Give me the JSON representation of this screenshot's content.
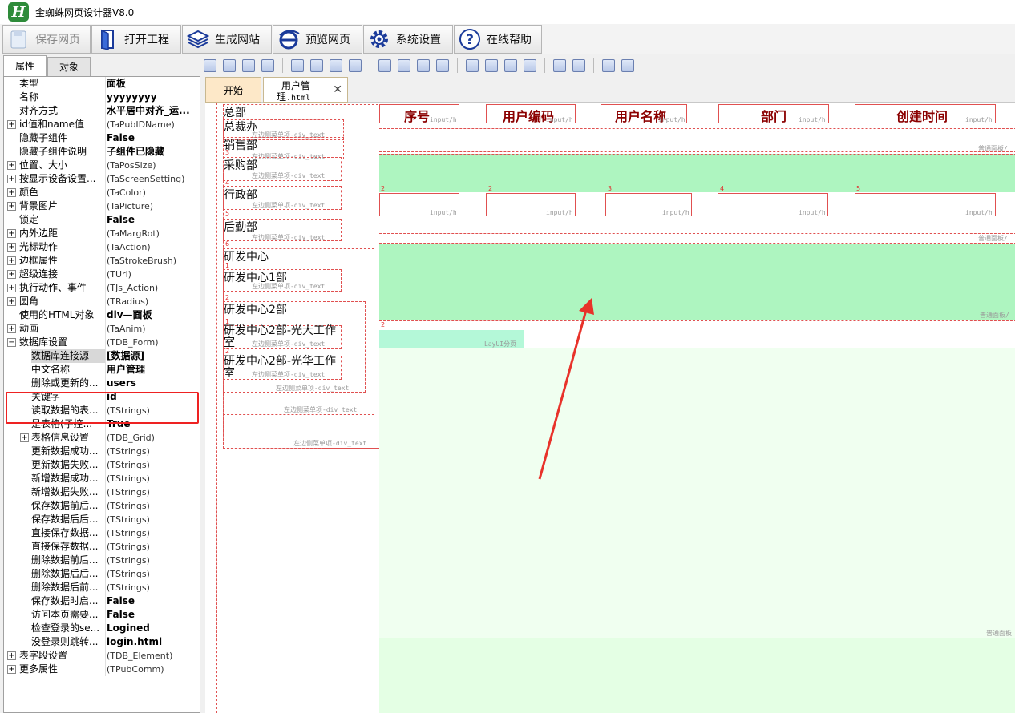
{
  "app": {
    "title": "金蜘蛛网页设计器V8.0",
    "logo": "H"
  },
  "toolbar": [
    {
      "label": "保存网页",
      "icon": "save-icon",
      "disabled": true
    },
    {
      "label": "打开工程",
      "icon": "open-project-icon"
    },
    {
      "label": "生成网站",
      "icon": "layers-icon"
    },
    {
      "label": "预览网页",
      "icon": "ie-browser-icon"
    },
    {
      "label": "系统设置",
      "icon": "gear-icon"
    },
    {
      "label": "在线帮助",
      "icon": "help-icon"
    }
  ],
  "panel_tabs": [
    "属性",
    "对象"
  ],
  "properties": [
    {
      "name": "类型",
      "value": "面板",
      "bold": true,
      "indent": 0
    },
    {
      "name": "名称",
      "value": "yyyyyyyy",
      "bold": true,
      "indent": 0
    },
    {
      "name": "对齐方式",
      "value": "水平居中对齐_运...",
      "bold": true,
      "indent": 0
    },
    {
      "name": "id值和name值",
      "value": "(TaPubIDName)",
      "expand": "+",
      "indent": 0
    },
    {
      "name": "隐藏子组件",
      "value": "False",
      "bold": true,
      "indent": 0
    },
    {
      "name": "隐藏子组件说明",
      "value": "子组件已隐藏",
      "bold": true,
      "indent": 0
    },
    {
      "name": "位置、大小",
      "value": "(TaPosSize)",
      "expand": "+",
      "indent": 0
    },
    {
      "name": "按显示设备设置...",
      "value": "(TaScreenSetting)",
      "expand": "+",
      "indent": 0
    },
    {
      "name": "颜色",
      "value": "(TaColor)",
      "expand": "+",
      "indent": 0
    },
    {
      "name": "背景图片",
      "value": "(TaPicture)",
      "expand": "+",
      "indent": 0
    },
    {
      "name": "锁定",
      "value": "False",
      "bold": true,
      "indent": 0
    },
    {
      "name": "内外边距",
      "value": "(TaMargRot)",
      "expand": "+",
      "indent": 0
    },
    {
      "name": "光标动作",
      "value": "(TaAction)",
      "expand": "+",
      "indent": 0
    },
    {
      "name": "边框属性",
      "value": "(TaStrokeBrush)",
      "expand": "+",
      "indent": 0
    },
    {
      "name": "超级连接",
      "value": "(TUrl)",
      "expand": "+",
      "indent": 0
    },
    {
      "name": "执行动作、事件",
      "value": "(TJs_Action)",
      "expand": "+",
      "indent": 0
    },
    {
      "name": "圆角",
      "value": "(TRadius)",
      "expand": "+",
      "indent": 0
    },
    {
      "name": "使用的HTML对象",
      "value": "div—面板",
      "bold": true,
      "indent": 0
    },
    {
      "name": "动画",
      "value": "(TaAnim)",
      "expand": "+",
      "indent": 0
    },
    {
      "name": "数据库设置",
      "value": "(TDB_Form)",
      "expand": "−",
      "indent": 0
    },
    {
      "name": "数据库连接源",
      "value": "[数据源]",
      "bold": true,
      "indent": 1,
      "selected": true
    },
    {
      "name": "中文名称",
      "value": "用户管理",
      "bold": true,
      "indent": 1
    },
    {
      "name": "删除或更新的...",
      "value": "users",
      "bold": true,
      "indent": 1
    },
    {
      "name": "关键字",
      "value": "id",
      "bold": true,
      "indent": 1
    },
    {
      "name": "读取数据的表...",
      "value": "(TStrings)",
      "indent": 1
    },
    {
      "name": "是表格(子控...",
      "value": "True",
      "bold": true,
      "indent": 1
    },
    {
      "name": "表格信息设置",
      "value": "(TDB_Grid)",
      "expand": "+",
      "indent": 1
    },
    {
      "name": "更新数据成功...",
      "value": "(TStrings)",
      "indent": 1
    },
    {
      "name": "更新数据失败...",
      "value": "(TStrings)",
      "indent": 1
    },
    {
      "name": "新增数据成功...",
      "value": "(TStrings)",
      "indent": 1
    },
    {
      "name": "新增数据失败...",
      "value": "(TStrings)",
      "indent": 1
    },
    {
      "name": "保存数据前后...",
      "value": "(TStrings)",
      "indent": 1
    },
    {
      "name": "保存数据后后...",
      "value": "(TStrings)",
      "indent": 1
    },
    {
      "name": "直接保存数据...",
      "value": "(TStrings)",
      "indent": 1
    },
    {
      "name": "直接保存数据...",
      "value": "(TStrings)",
      "indent": 1
    },
    {
      "name": "删除数据前后...",
      "value": "(TStrings)",
      "indent": 1
    },
    {
      "name": "删除数据后后...",
      "value": "(TStrings)",
      "indent": 1
    },
    {
      "name": "删除数据后前...",
      "value": "(TStrings)",
      "indent": 1
    },
    {
      "name": "保存数据时启...",
      "value": "False",
      "bold": true,
      "indent": 1
    },
    {
      "name": "访问本页需要...",
      "value": "False",
      "bold": true,
      "indent": 1
    },
    {
      "name": "检查登录的se...",
      "value": "Logined",
      "bold": true,
      "indent": 1
    },
    {
      "name": "没登录则跳转...",
      "value": "login.html",
      "bold": true,
      "indent": 1
    },
    {
      "name": "表字段设置",
      "value": "(TDB_Element)",
      "expand": "+",
      "indent": 0
    },
    {
      "name": "更多属性",
      "value": "(TPubComm)",
      "expand": "+",
      "indent": 0
    }
  ],
  "doc_tabs": {
    "start": "开始",
    "file_line1": "用户管",
    "file_line2": "理",
    "file_ext": ".html",
    "close": "✕"
  },
  "menu": {
    "items": [
      "总部",
      "总裁办",
      "销售部",
      "采购部",
      "行政部",
      "后勤部",
      "研发中心",
      "研发中心1部",
      "研发中心2部",
      "研发中心2部-光大工作室",
      "研发中心2部-光华工作室"
    ],
    "numbers": [
      "3",
      "4",
      "5",
      "6",
      "1",
      "2",
      "1",
      "2"
    ],
    "item_tag": "左边侧菜单项-div_text"
  },
  "grid": {
    "headers": [
      "序号",
      "用户编码",
      "用户名称",
      "部门",
      "创建时间"
    ],
    "input_tag": "input/h",
    "row_numbers": [
      "2",
      "2",
      "3",
      "4",
      "5"
    ],
    "panel_tag": "普通面板/",
    "panel_tag_short": "普通面板",
    "pager": "LayUI分页",
    "pager_num": "2"
  }
}
